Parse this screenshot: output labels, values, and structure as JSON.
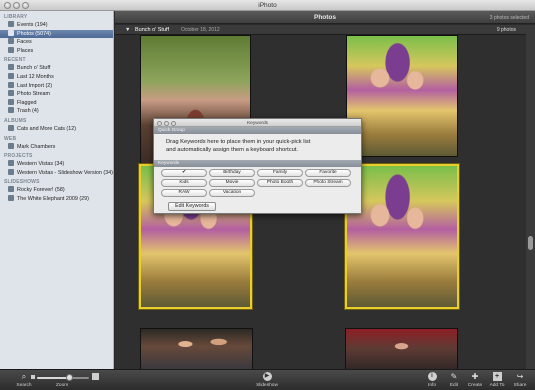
{
  "window": {
    "title": "iPhoto"
  },
  "sidebar": {
    "sections": [
      {
        "heading": "LIBRARY",
        "items": [
          {
            "label": "Events (194)",
            "icon": "events-icon",
            "selected": false
          },
          {
            "label": "Photos (5074)",
            "icon": "photos-icon",
            "selected": true
          },
          {
            "label": "Faces",
            "icon": "faces-icon",
            "selected": false
          },
          {
            "label": "Places",
            "icon": "places-icon",
            "selected": false
          }
        ]
      },
      {
        "heading": "RECENT",
        "items": [
          {
            "label": "Bunch o' Stuff",
            "icon": "event-icon",
            "selected": false
          },
          {
            "label": "Last 12 Months",
            "icon": "calendar-icon",
            "selected": false
          },
          {
            "label": "Last Import (2)",
            "icon": "clock-icon",
            "selected": false
          },
          {
            "label": "Photo Stream",
            "icon": "photo-stream-icon",
            "selected": false
          },
          {
            "label": "Flagged",
            "icon": "flag-icon",
            "selected": false
          },
          {
            "label": "Trash (4)",
            "icon": "trash-icon",
            "selected": false
          }
        ]
      },
      {
        "heading": "ALBUMS",
        "items": [
          {
            "label": "Cats and More Cats (12)",
            "icon": "album-icon",
            "selected": false
          }
        ]
      },
      {
        "heading": "WEB",
        "items": [
          {
            "label": "Mark Chambers",
            "icon": "web-icon",
            "selected": false
          }
        ]
      },
      {
        "heading": "PROJECTS",
        "items": [
          {
            "label": "Western Vistas (34)",
            "icon": "project-icon",
            "selected": false
          },
          {
            "label": "Western Vistas - Slideshow Version (34)",
            "icon": "project-icon",
            "selected": false
          }
        ]
      },
      {
        "heading": "SLIDESHOWS",
        "items": [
          {
            "label": "Rocky Forever! (58)",
            "icon": "slideshow-icon",
            "selected": false
          },
          {
            "label": "The White Elephant 2009 (29)",
            "icon": "slideshow-icon",
            "selected": false
          }
        ]
      }
    ]
  },
  "header": {
    "title": "Photos",
    "selection_status": "3 photos selected"
  },
  "event": {
    "name": "Bunch o' Stuff",
    "date": "October 18, 2012",
    "count": "9 photos"
  },
  "keywords_window": {
    "title": "Keywords",
    "quick_group_label": "Quick Group",
    "instructions_line1": "Drag Keywords here to place them in your quick-pick list",
    "instructions_line2": "and automatically assign them a keyboard shortcut.",
    "keywords_label": "Keywords",
    "keywords": [
      "✔",
      "Birthday",
      "Family",
      "Favorite",
      "Kids",
      "Movie",
      "Photo Booth",
      "Photo Stream",
      "RAW",
      "Vacation"
    ],
    "edit_button": "Edit Keywords"
  },
  "toolbar": {
    "search": "Search",
    "zoom": "Zoom",
    "zoom_level": 0.62,
    "slideshow": "Slideshow",
    "info": "Info",
    "edit": "Edit",
    "create": "Create",
    "add_to": "Add To",
    "share": "Share"
  }
}
